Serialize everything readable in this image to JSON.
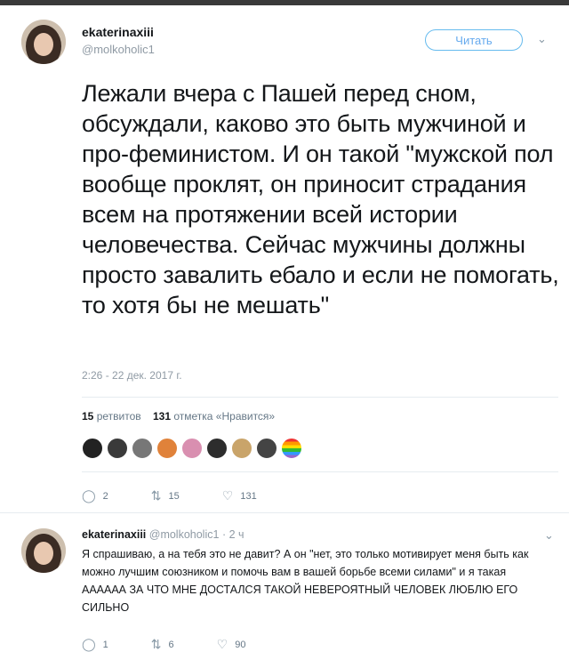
{
  "tweet": {
    "author_name": "ekaterinaxiii",
    "author_handle": "@molkoholic1",
    "follow_label": "Читать",
    "text": "Лежали вчера с Пашей перед сном, обсуждали, каково это быть мужчиной и про-феминистом. И он такой \"мужской пол вообще проклят, он приносит страдания всем на протяжении всей истории человечества. Сейчас мужчины должны просто завалить ебало и если не помогать, то хотя бы не мешать\"",
    "timestamp": "2:26 - 22 дек. 2017 г.",
    "retweets_count": "15",
    "retweets_label": "ретвитов",
    "likes_count": "131",
    "likes_label": "отметка «Нравится»",
    "actions": {
      "replies": "2",
      "retweets": "15",
      "likes": "131"
    }
  },
  "reply": {
    "author_name": "ekaterinaxiii",
    "author_handle": "@molkoholic1",
    "time": "· 2 ч",
    "text": "Я спрашиваю, а на тебя это не давит? А он \"нет, это только мотивирует меня быть как можно лучшим союзником и помочь вам в вашей борьбе всеми силами\" и я такая АААААА ЗА ЧТО МНЕ ДОСТАЛСЯ ТАКОЙ НЕВЕРОЯТНЫЙ ЧЕЛОВЕК ЛЮБЛЮ ЕГО СИЛЬНО",
    "actions": {
      "replies": "1",
      "retweets": "6",
      "likes": "90"
    }
  },
  "colors": {
    "accent": "#66aaee",
    "muted": "#8f9aa4",
    "text": "#14171a"
  },
  "icons": {
    "reply": "reply-icon",
    "retweet": "retweet-icon",
    "like": "heart-icon",
    "menu": "chevron-down-icon"
  }
}
